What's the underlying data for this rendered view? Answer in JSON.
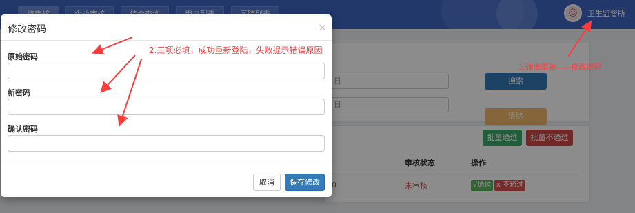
{
  "header": {
    "tabs": [
      "待审核",
      "企业审核",
      "综合查询",
      "用户列表",
      "医院列表"
    ],
    "user_name": "卫生监督所",
    "avatar_icon": "user-avatar"
  },
  "search": {
    "field1_tail": "日",
    "field2_tail": "日",
    "search_label": "搜索",
    "clear_label": "清除"
  },
  "table": {
    "batch_pass_label": "批量通过",
    "batch_reject_label": "批量不通过",
    "col_status": "审核状态",
    "col_actions": "操作",
    "row_digit": "0",
    "row_status": "未审核",
    "row_pass_label": "√通过",
    "row_reject_label": "x 不通过"
  },
  "modal": {
    "title": "修改密码",
    "close_glyph": "×",
    "field_old_label": "原始密码",
    "field_new_label": "新密码",
    "field_confirm_label": "确认密码",
    "cancel_label": "取消",
    "save_label": "保存修改"
  },
  "annotations": {
    "note_fields": "2.三项必填，成功重新登陆，失败提示错误原因",
    "note_menu": "1.弹出菜单——修改密码"
  },
  "colors": {
    "header_bg": "#3f66c3",
    "primary": "#337ab7",
    "annotation": "#ff3b3b"
  }
}
